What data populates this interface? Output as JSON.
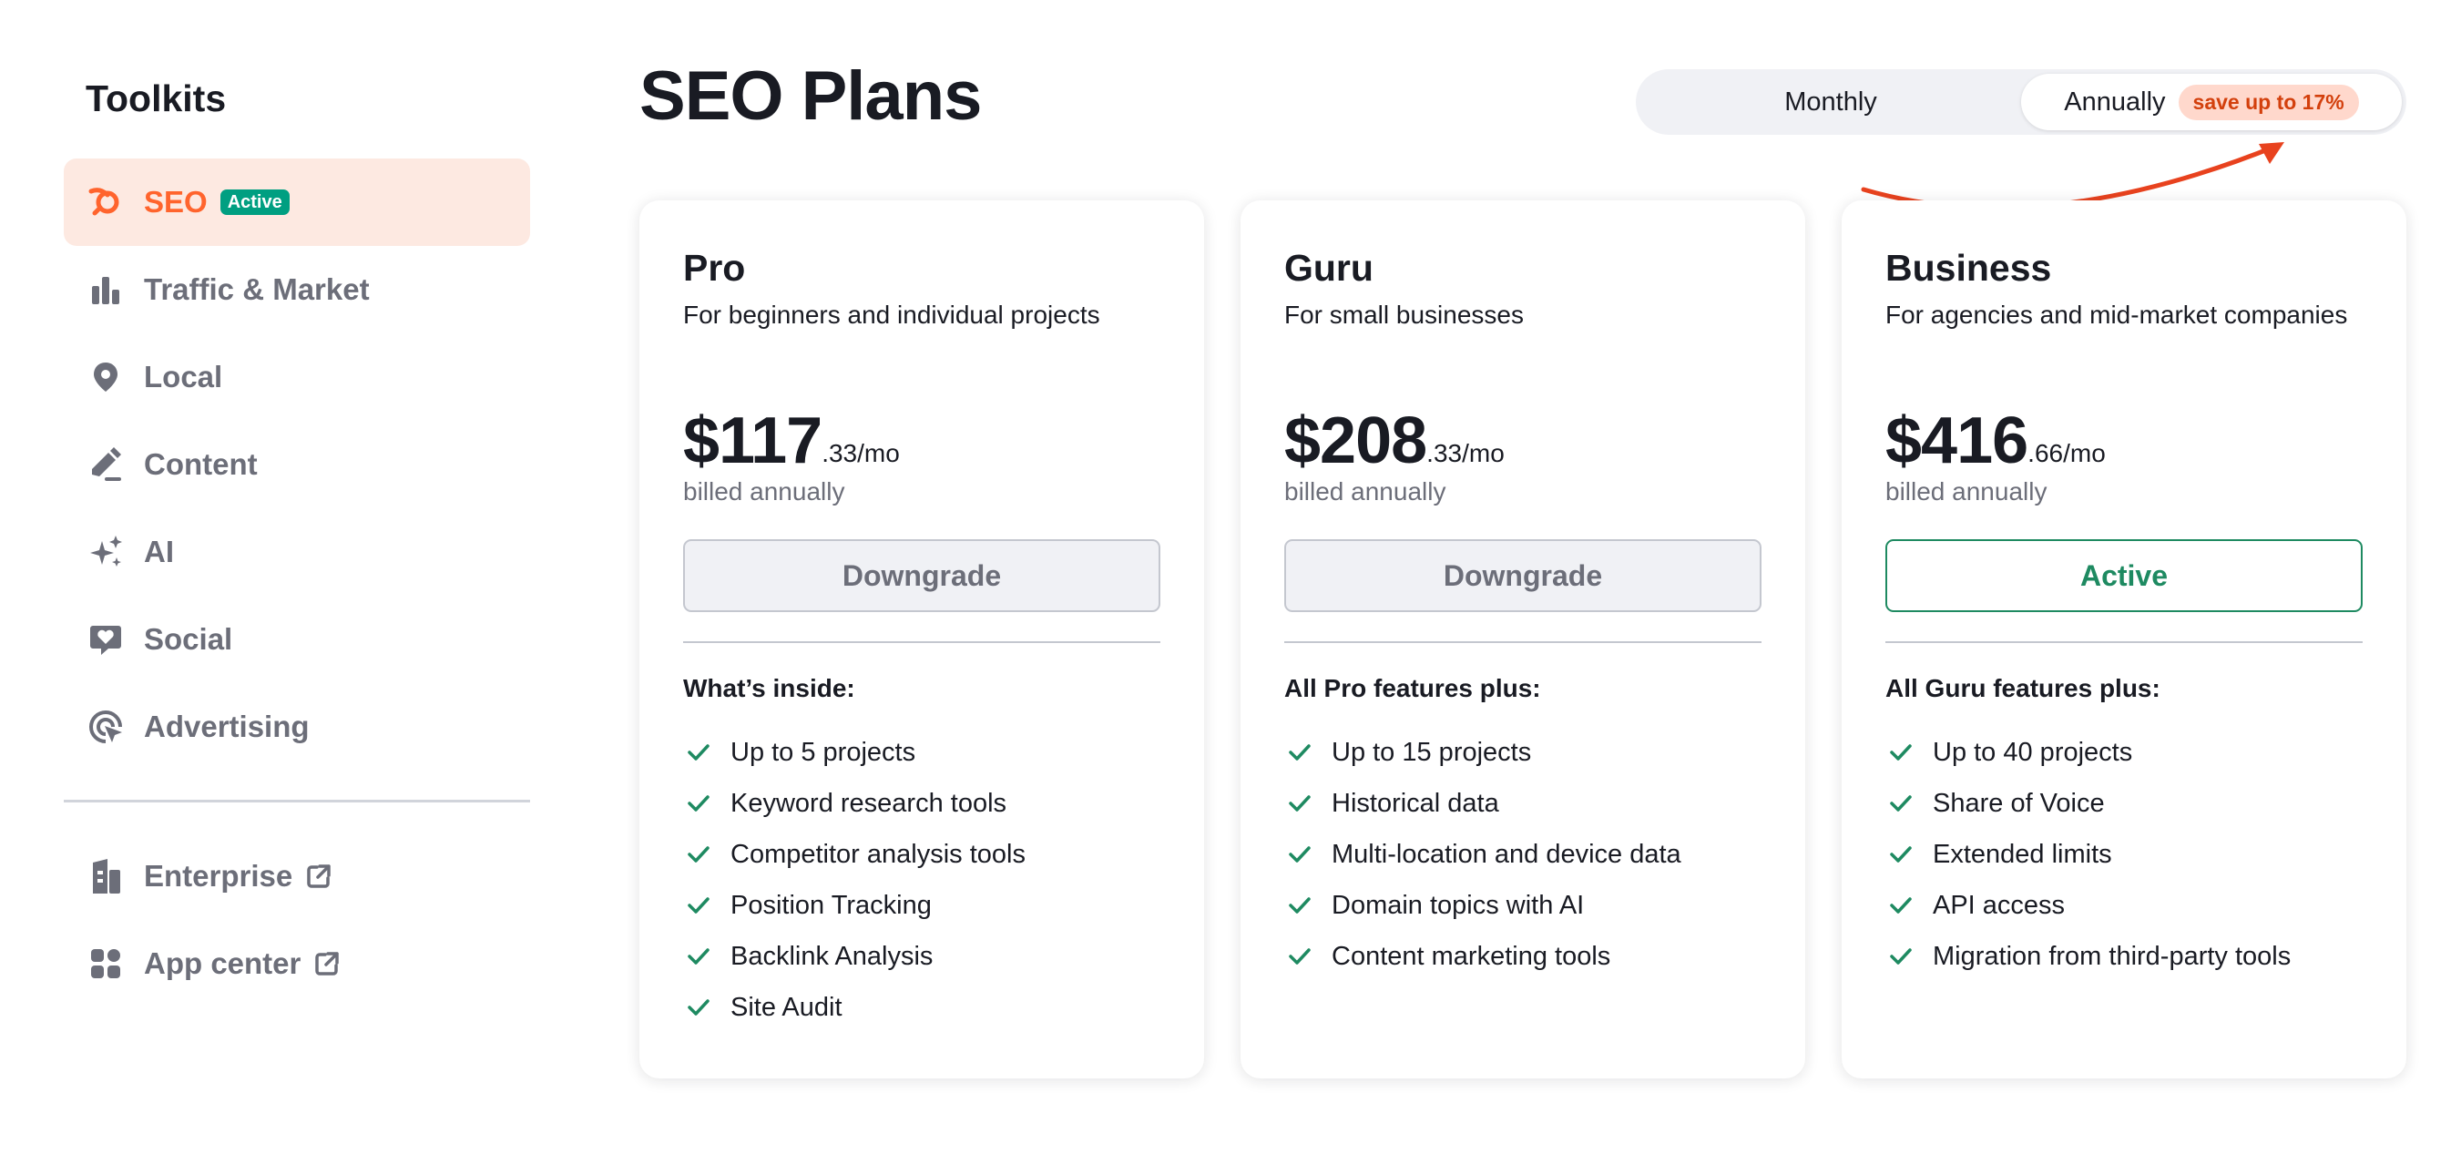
{
  "sidebar": {
    "title": "Toolkits",
    "items": [
      {
        "label": "SEO",
        "icon": "seo-logo-icon",
        "badge": "Active",
        "active": true
      },
      {
        "label": "Traffic & Market",
        "icon": "bar-chart-icon"
      },
      {
        "label": "Local",
        "icon": "map-pin-icon"
      },
      {
        "label": "Content",
        "icon": "pen-icon"
      },
      {
        "label": "AI",
        "icon": "sparkles-icon"
      },
      {
        "label": "Social",
        "icon": "heart-chat-icon"
      },
      {
        "label": "Advertising",
        "icon": "target-cursor-icon"
      }
    ],
    "external_items": [
      {
        "label": "Enterprise",
        "icon": "building-icon"
      },
      {
        "label": "App center",
        "icon": "apps-grid-icon"
      }
    ]
  },
  "header": {
    "title": "SEO Plans",
    "billing_toggle": {
      "monthly_label": "Monthly",
      "annually_label": "Annually",
      "save_badge": "save up to 17%",
      "selected": "annually"
    }
  },
  "plans": [
    {
      "name": "Pro",
      "description": "For beginners and individual projects",
      "price_main": "$117",
      "price_suffix": ".33/mo",
      "billing_note": "billed annually",
      "button_label": "Downgrade",
      "features_heading": "What’s inside:",
      "features": [
        "Up to 5 projects",
        "Keyword research tools",
        "Competitor analysis tools",
        "Position Tracking",
        "Backlink Analysis",
        "Site Audit"
      ]
    },
    {
      "name": "Guru",
      "description": "For small businesses",
      "price_main": "$208",
      "price_suffix": ".33/mo",
      "billing_note": "billed annually",
      "button_label": "Downgrade",
      "features_heading": "All Pro features plus:",
      "features": [
        "Up to 15 projects",
        "Historical data",
        "Multi-location and device data",
        "Domain topics with AI",
        "Content marketing tools"
      ]
    },
    {
      "name": "Business",
      "description": "For agencies and mid-market companies",
      "price_main": "$416",
      "price_suffix": ".66/mo",
      "billing_note": "billed annually",
      "button_label": "Active",
      "features_heading": "All Guru features plus:",
      "features": [
        "Up to 40 projects",
        "Share of Voice",
        "Extended limits",
        "API access",
        "Migration from third-party tools"
      ]
    }
  ],
  "colors": {
    "brand_orange": "#ff642d",
    "active_green": "#1e8a61",
    "badge_green": "#009f81",
    "check_green": "#1e8a61",
    "muted_text": "#6c6e79",
    "arrow_red": "#e8421e"
  }
}
